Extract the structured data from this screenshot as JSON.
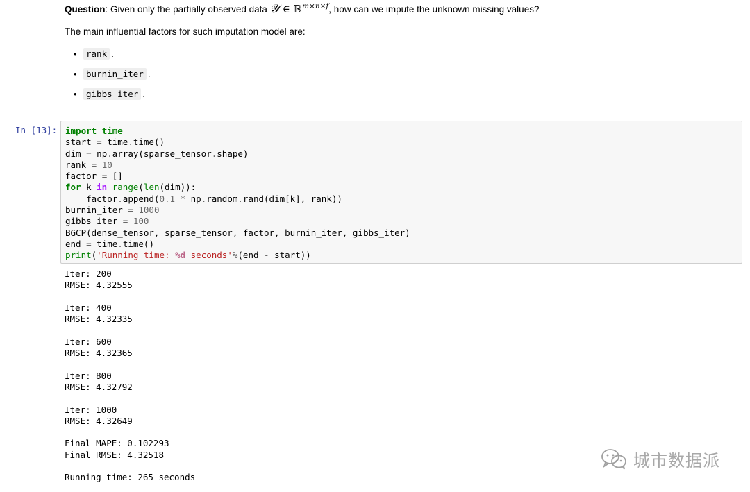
{
  "markdown": {
    "question_label": "Question",
    "question_text_before": ": Given only the partially observed data ",
    "math_symbol": "𝒴",
    "math_in": " ∈ ",
    "math_set": "ℝ",
    "math_sup": "m×n×f",
    "question_text_after": ", how can we impute the unknown missing values?",
    "intro": "The main influential factors for such imputation model are:",
    "bullets": [
      {
        "code": "rank",
        "punct": "."
      },
      {
        "code": "burnin_iter",
        "punct": "."
      },
      {
        "code": "gibbs_iter",
        "punct": "."
      }
    ]
  },
  "cell": {
    "prompt": "In [13]:",
    "code_lines": [
      "import time",
      "start = time.time()",
      "dim = np.array(sparse_tensor.shape)",
      "rank = 10",
      "factor = []",
      "for k in range(len(dim)):",
      "    factor.append(0.1 * np.random.rand(dim[k], rank))",
      "burnin_iter = 1000",
      "gibbs_iter = 100",
      "BGCP(dense_tensor, sparse_tensor, factor, burnin_iter, gibbs_iter)",
      "end = time.time()",
      "print('Running time: %d seconds'%(end - start))"
    ]
  },
  "output_lines": [
    "Iter: 200",
    "RMSE: 4.32555",
    "",
    "Iter: 400",
    "RMSE: 4.32335",
    "",
    "Iter: 600",
    "RMSE: 4.32365",
    "",
    "Iter: 800",
    "RMSE: 4.32792",
    "",
    "Iter: 1000",
    "RMSE: 4.32649",
    "",
    "Final MAPE: 0.102293",
    "Final RMSE: 4.32518",
    "",
    "Running time: 265 seconds"
  ],
  "watermark": {
    "text": "城市数据派",
    "icon": "wechat-icon"
  },
  "colors": {
    "prompt": "#303f9f",
    "keyword": "#008000",
    "operator_keyword": "#aa22ff",
    "number": "#666666",
    "string": "#ba2121",
    "cell_background": "#f7f7f7",
    "cell_border": "#cfcfcf"
  }
}
